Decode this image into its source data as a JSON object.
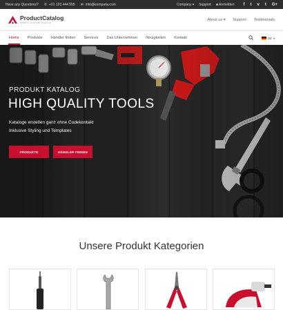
{
  "topbar": {
    "question": "Have any Questions?",
    "phone": "+01 123 444 555",
    "email": "info@company.com",
    "company_menu": "Company",
    "support": "Support",
    "login": "Anmelden",
    "social": [
      "f",
      "t",
      "v",
      "t",
      "G+"
    ]
  },
  "header": {
    "logo_title": "ProductCatalog",
    "logo_tagline": "SIMPLY CUSTOM CATALOG",
    "nav": [
      "About us",
      "Support",
      "Testimonials"
    ]
  },
  "nav": {
    "items": [
      "Home",
      "Produkte",
      "Händler finden",
      "Services",
      "Das Unternehmen",
      "Neuigkeiten",
      "Kontakt"
    ],
    "active": "Home",
    "language": "DE"
  },
  "hero": {
    "subtitle": "PRODUKT KATALOG",
    "title": "HIGH QUALITY TOOLS",
    "desc_line1": "Kataloge erstellen ganz ohne Codekontakt",
    "desc_line2": "Inklusive Styling und Templates",
    "btn_products": "PRODUKTE",
    "btn_dealers": "HÄNDLER FINDEN"
  },
  "categories": {
    "title": "Unsere Produkt Kategorien"
  },
  "colors": {
    "accent": "#c8102e",
    "topbar": "#2e2e2e"
  }
}
